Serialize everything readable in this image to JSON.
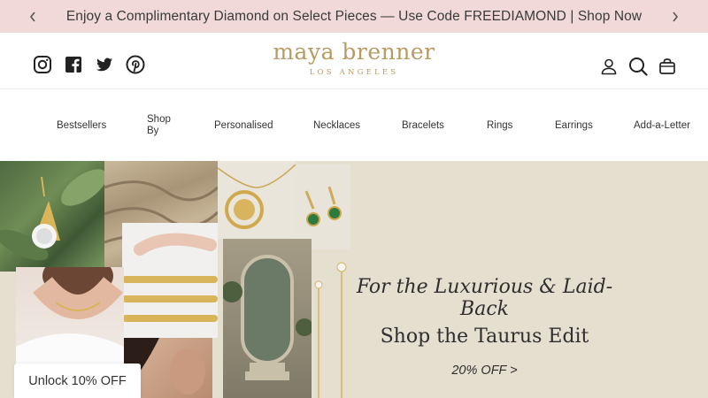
{
  "announcement": {
    "message": "Enjoy a Complimentary Diamond on Select Pieces — Use Code FREEDIAMOND | Shop Now",
    "prev_icon": "chevron-left-icon",
    "next_icon": "chevron-right-icon"
  },
  "header": {
    "brand": "maya brenner",
    "location": "LOS ANGELES",
    "social_icons": [
      "instagram-icon",
      "facebook-icon",
      "twitter-icon",
      "pinterest-icon"
    ],
    "utility_icons": [
      "account-icon",
      "search-icon",
      "bag-icon"
    ]
  },
  "nav": {
    "items": [
      "Bestsellers",
      "Shop By",
      "Personalised",
      "Necklaces",
      "Bracelets",
      "Rings",
      "Earrings",
      "Add-a-Letter"
    ]
  },
  "hero": {
    "line1": "For the Luxurious & Laid-Back",
    "line2": "Shop the Taurus Edit",
    "cta": "20% OFF >"
  },
  "popup": {
    "unlock_label": "Unlock 10% OFF"
  },
  "colors": {
    "announcement_bg": "#f1d9d9",
    "brand_gold": "#b89a63",
    "hero_bg": "#e5dfd0"
  }
}
